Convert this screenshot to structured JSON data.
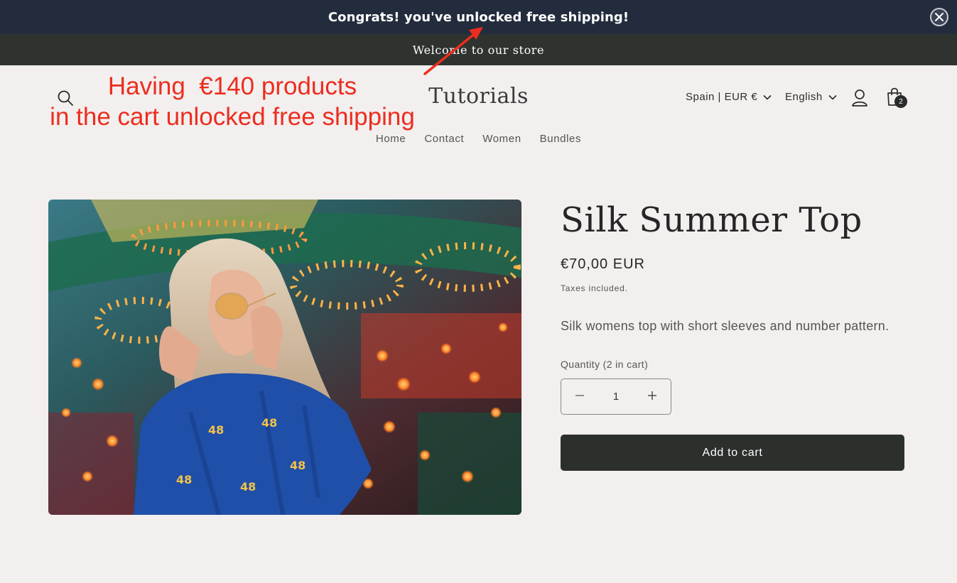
{
  "shipping_bar": {
    "message": "Congrats! you've unlocked free shipping!",
    "close_icon": "close-icon"
  },
  "announcement": {
    "text": "Welcome to our store"
  },
  "annotation": {
    "line1": "Having  €140 products",
    "line2": "in the cart unlocked free shipping",
    "color": "#ec2d1f"
  },
  "header": {
    "logo": "Tutorials",
    "country": "Spain | EUR €",
    "language": "English",
    "cart_count": "2",
    "icons": [
      "search-icon",
      "account-icon",
      "cart-icon",
      "chevron-down-icon"
    ]
  },
  "nav": {
    "items": [
      "Home",
      "Contact",
      "Women",
      "Bundles"
    ]
  },
  "product": {
    "title": "Silk Summer Top",
    "price": "€70,00 EUR",
    "tax_note": "Taxes included.",
    "description": "Silk womens top with short sleeves and number pattern.",
    "quantity_label": "Quantity (2 in cart)",
    "quantity_value": "1",
    "add_to_cart": "Add to cart",
    "shirt_print": "48"
  },
  "colors": {
    "shipping_bar_bg": "#232c3c",
    "announcement_bg": "#2f332f",
    "page_bg": "#f2efee",
    "button_bg": "#2b302d"
  }
}
